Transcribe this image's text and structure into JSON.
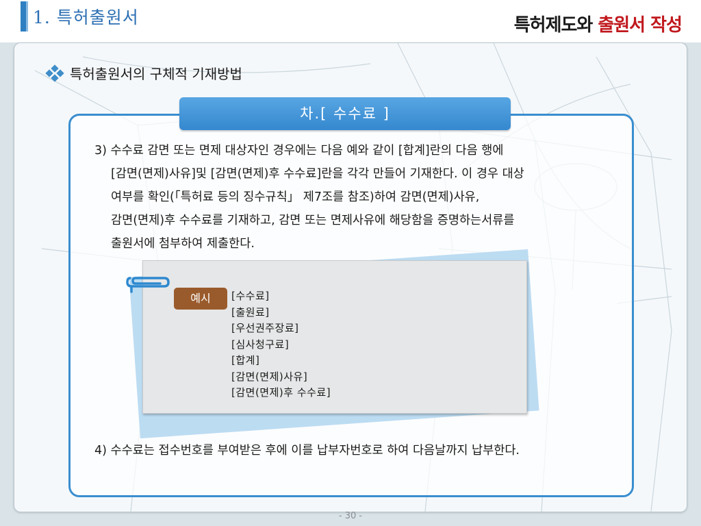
{
  "header": {
    "section_title": "1. 특허출원서",
    "brand_part1": "특허제도와",
    "brand_part2": "출원서 작성"
  },
  "heading": "특허출원서의 구체적 기재방법",
  "tab_title": "차.[ 수수료 ]",
  "paragraph3_lines": [
    "3) 수수료 감면 또는 면제 대상자인 경우에는 다음 예와 같이 [합계]란의 다음 행에",
    "[감면(면제)사유]및 [감면(면제)후 수수료]란을 각각 만들어 기재한다. 이 경우 대상",
    "여부를 확인(「특허료 등의 징수규칙」 제7조를 참조)하여 감면(면제)사유,",
    "감면(면제)후 수수료를 기재하고, 감면 또는 면제사유에 해당함을 증명하는서류를",
    "출원서에 첨부하여 제출한다."
  ],
  "example_label": "예시",
  "fee_items": [
    "[수수료]",
    "[출원료]",
    "[우선권주장료]",
    "[심사청구료]",
    "[합계]",
    "[감면(면제)사유]",
    "[감면(면제)후 수수료]"
  ],
  "paragraph4": "4) 수수료는 접수번호를 부여받은 후에 이를 납부자번호로 하여 다음날까지 납부한다.",
  "page_number": "- 30 -",
  "colors": {
    "accent_blue": "#3a8ed0",
    "brand_red": "#c0181d",
    "tag_brown": "#9a5b2c"
  }
}
